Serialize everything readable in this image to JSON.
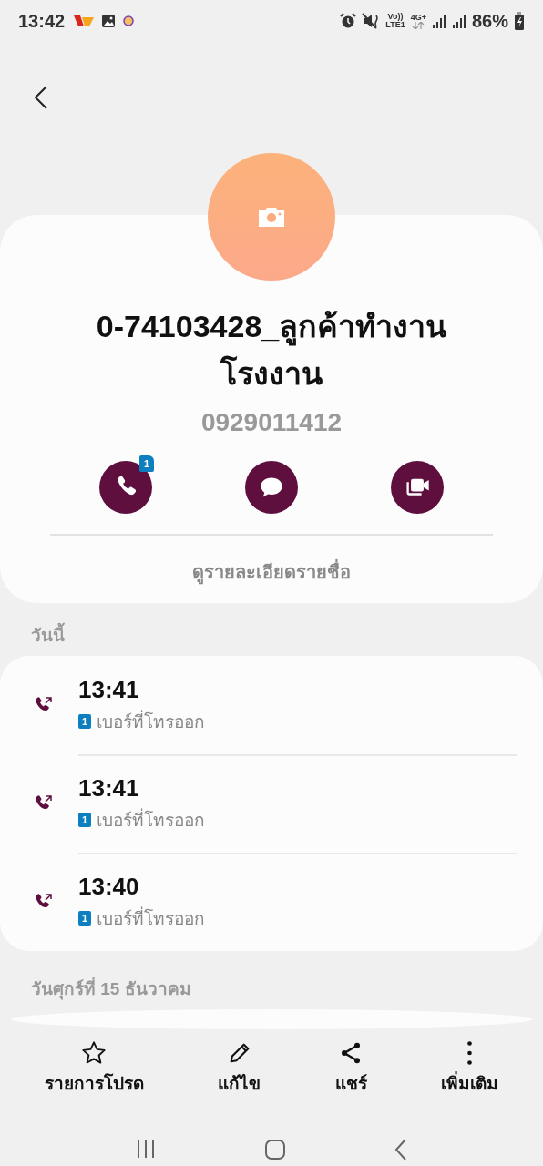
{
  "status_bar": {
    "time": "13:42",
    "volte": "Vo))",
    "lte": "LTE1",
    "network": "4G+",
    "battery": "86%"
  },
  "contact": {
    "name": "0-74103428_ลูกค้าทำงานโรงงาน",
    "number": "0929011412"
  },
  "actions": [
    {
      "kind": "call",
      "badge": "1"
    },
    {
      "kind": "message"
    },
    {
      "kind": "video"
    }
  ],
  "details_link": "ดูรายละเอียดรายชื่อ",
  "sections": [
    {
      "label": "วันนี้",
      "calls": [
        {
          "time": "13:41",
          "sim": "1",
          "type": "เบอร์ที่โทรออก"
        },
        {
          "time": "13:41",
          "sim": "1",
          "type": "เบอร์ที่โทรออก"
        },
        {
          "time": "13:40",
          "sim": "1",
          "type": "เบอร์ที่โทรออก"
        }
      ]
    },
    {
      "label": "วันศุกร์ที่ 15 ธันวาคม"
    }
  ],
  "bottom_bar": [
    {
      "kind": "favorite",
      "label": "รายการโปรด"
    },
    {
      "kind": "edit",
      "label": "แก้ไข"
    },
    {
      "kind": "share",
      "label": "แชร์"
    },
    {
      "kind": "more",
      "label": "เพิ่มเติม"
    }
  ]
}
